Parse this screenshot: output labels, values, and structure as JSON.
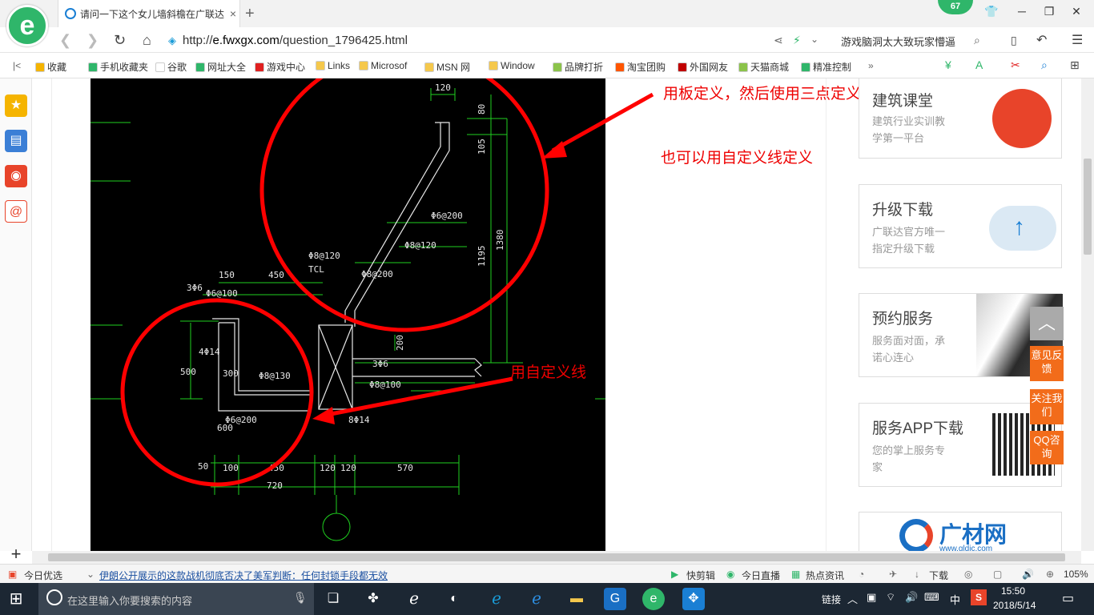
{
  "browser": {
    "tab_title": "请问一下这个女儿墙斜檐在广联达",
    "tab_close": "×",
    "new_tab": "+",
    "notification_count": "67",
    "url_prefix": "http://",
    "url_domain": "e.fwxgx.com",
    "url_path": "/question_1796425.html",
    "search_text": "游戏脑洞太大致玩家懵逼",
    "logo_letter": "e"
  },
  "bookmarks": [
    {
      "label": "收藏",
      "color": "#f5b400"
    },
    {
      "label": "手机收藏夹",
      "color": "#2fb66a"
    },
    {
      "label": "谷歌",
      "color": "#ffffff"
    },
    {
      "label": "网址大全",
      "color": "#2fb66a"
    },
    {
      "label": "游戏中心",
      "color": "#e02020"
    },
    {
      "label": "Links",
      "color": "#f5c84c"
    },
    {
      "label": "Microsof",
      "color": "#f5c84c"
    },
    {
      "label": "MSN 网",
      "color": "#f5c84c"
    },
    {
      "label": "Window",
      "color": "#f5c84c"
    },
    {
      "label": "品牌打折",
      "color": "#8bc34a"
    },
    {
      "label": "淘宝团购",
      "color": "#ff5500"
    },
    {
      "label": "外国网友",
      "color": "#c00000"
    },
    {
      "label": "天猫商城",
      "color": "#8bc34a"
    },
    {
      "label": "精准控制",
      "color": "#2fb66a"
    }
  ],
  "annotations": {
    "top": "用板定义，然后使用三点定义斜板",
    "middle": "也可以用自定义线定义",
    "bottom": "用自定义线"
  },
  "drawing": {
    "dims_top": [
      "120",
      "80",
      "105",
      "1195",
      "1380",
      "200"
    ],
    "rebar_labels": [
      "Φ6@200",
      "Φ8@120",
      "Φ8@120",
      "TCL",
      "Φ8@200",
      "3Φ6",
      "Φ6@100",
      "4Φ14",
      "500",
      "300",
      "Φ8@130",
      "Φ6@200",
      "3Φ6",
      "Φ8@100",
      "8Φ14"
    ],
    "dims_left": [
      "150",
      "450",
      "600"
    ],
    "dims_bottom": [
      "50",
      "100",
      "450",
      "120",
      "120",
      "570",
      "720"
    ]
  },
  "cards": [
    {
      "title": "建筑课堂",
      "desc1": "建筑行业实训教",
      "desc2": "学第一平台"
    },
    {
      "title": "升级下载",
      "desc1": "广联达官方唯一",
      "desc2": "指定升级下载"
    },
    {
      "title": "预约服务",
      "desc1": "服务面对面，承",
      "desc2": "诺心连心"
    },
    {
      "title": "服务APP下载",
      "desc1": "您的掌上服务专",
      "desc2": "家"
    },
    {
      "title": "广材网",
      "desc1": "www.gldjc.com",
      "desc2": ""
    }
  ],
  "float_buttons": {
    "top": "︿",
    "feedback": "意见反馈",
    "follow": "关注我们",
    "qq": "QQ咨询"
  },
  "status": {
    "daily": "今日优选",
    "news": "伊朗公开展示的这款战机彻底否决了美军判断：任何封锁手段都无效",
    "quick_cut": "快剪辑",
    "live": "今日直播",
    "hot": "热点资讯",
    "download": "下载",
    "zoom": "105%"
  },
  "taskbar": {
    "search_placeholder": "在这里输入你要搜索的内容",
    "link": "链接",
    "ime": "中",
    "time": "15:50",
    "date": "2018/5/14"
  }
}
